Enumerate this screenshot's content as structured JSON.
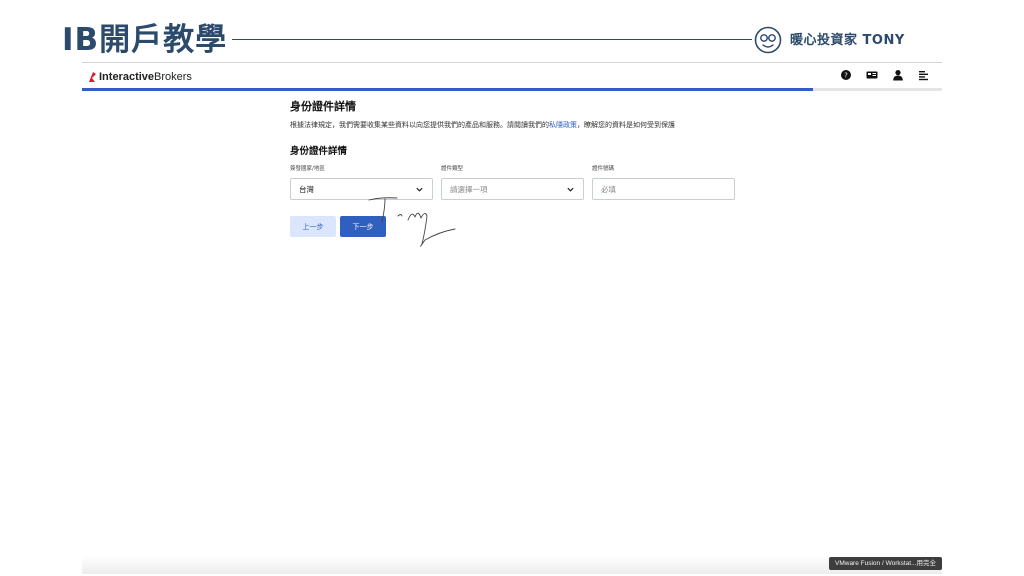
{
  "slide": {
    "title": "IB開戶教學",
    "brand_name": "暖心投資家 TONY",
    "signature_text": "Tony"
  },
  "ib": {
    "logo_bold": "Interactive",
    "logo_regular": "Brokers",
    "top_icons": [
      "help-icon",
      "id-card-icon",
      "user-icon",
      "menu-icon"
    ],
    "progress": 0.85,
    "page_title": "身份證件詳情",
    "notice_before": "根據法律規定，我們需要收集某些資料以向您提供我們的產品和服務。請閱讀我們的",
    "notice_link": "私隱政策",
    "notice_after": "，瞭解您的資料是如何受到保護",
    "section_title": "身份證件詳情",
    "fields": [
      {
        "label": "簽發國家/地區",
        "value": "台灣",
        "placeholder": false,
        "dropdown": true
      },
      {
        "label": "證件類型",
        "value": "請選擇一項",
        "placeholder": true,
        "dropdown": true
      },
      {
        "label": "證件號碼",
        "value": "必填",
        "placeholder": true,
        "dropdown": false
      }
    ],
    "prev_label": "上一步",
    "next_label": "下一步"
  },
  "tooltip": "VMware Fusion / Workstat...用完全",
  "colors": {
    "accent": "#2f5fbf",
    "slide_title": "#2c4a6b",
    "ib_logo_red": "#d81e2c"
  }
}
